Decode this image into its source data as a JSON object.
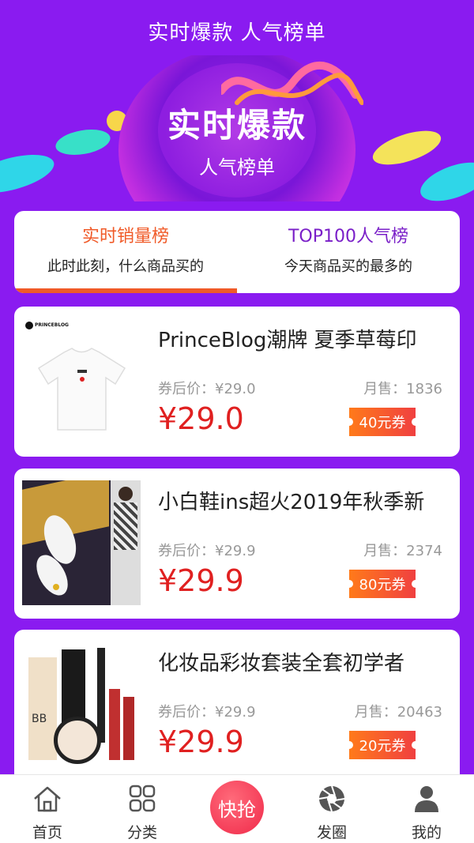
{
  "header": {
    "title": "实时爆款 人气榜单"
  },
  "banner": {
    "title": "实时爆款",
    "subtitle": "人气榜单"
  },
  "tabs": [
    {
      "title": "实时销量榜",
      "desc": "此时此刻，什么商品买的",
      "active": true,
      "color": "#f05a28"
    },
    {
      "title": "TOP100人气榜",
      "desc": "今天商品买的最多的",
      "active": false,
      "color": "#7a1fc8"
    }
  ],
  "products": [
    {
      "title": "PrinceBlog潮牌 夏季草莓印",
      "coupon_price": "券后价：¥29.0",
      "sales": "月售：1836",
      "price": "¥29.0",
      "coupon": "40元券",
      "brand_tag": "PRINCEBLOG"
    },
    {
      "title": "小白鞋ins超火2019年秋季新",
      "coupon_price": "券后价：¥29.9",
      "sales": "月售：2374",
      "price": "¥29.9",
      "coupon": "80元券"
    },
    {
      "title": "化妆品彩妆套装全套初学者",
      "coupon_price": "券后价：¥29.9",
      "sales": "月售：20463",
      "price": "¥29.9",
      "coupon": "20元券",
      "bb_tag": "BB"
    }
  ],
  "nav": {
    "items": [
      {
        "label": "首页",
        "icon": "home-icon"
      },
      {
        "label": "分类",
        "icon": "grid-icon"
      },
      {
        "label": "发圈",
        "icon": "aperture-icon"
      },
      {
        "label": "我的",
        "icon": "user-icon"
      }
    ],
    "center": {
      "label": "快抢"
    }
  },
  "colors": {
    "brand": "#8a1bf0",
    "price": "#e02020",
    "accent": "#f05a28"
  }
}
